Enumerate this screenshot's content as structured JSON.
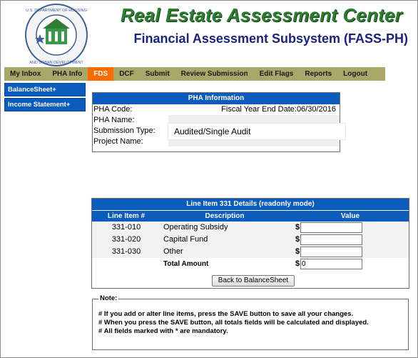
{
  "header": {
    "title": "Real Estate Assessment Center",
    "subtitle": "Financial Assessment Subsystem (FASS-PH)",
    "seal_text": "U.S. DEPARTMENT OF HOUSING AND URBAN DEVELOPMENT"
  },
  "nav": {
    "items": [
      "My Inbox",
      "PHA Info",
      "FDS",
      "DCF",
      "Submit",
      "Review Submission",
      "Edit Flags",
      "Reports",
      "Logout"
    ],
    "active": "FDS"
  },
  "leftmenu": {
    "items": [
      "BalanceSheet+",
      "Income Statement+"
    ]
  },
  "pha_info": {
    "heading": "PHA Information",
    "code_label": "PHA Code:",
    "fye_label": "Fiscal Year End Date:06/30/2016",
    "name_label": "PHA Name:",
    "submission_type_label": "Submission Type:",
    "submission_type_value": "Audited/Single Audit",
    "project_name_label": "Project Name:"
  },
  "line_item": {
    "heading": "Line Item 331 Details (readonly mode)",
    "columns": [
      "Line Item #",
      "Description",
      "Value"
    ],
    "rows": [
      {
        "code": "331-010",
        "desc": "Operating Subsidy",
        "value": ""
      },
      {
        "code": "331-020",
        "desc": "Capital Fund",
        "value": ""
      },
      {
        "code": "331-030",
        "desc": "Other",
        "value": ""
      }
    ],
    "currency": "$",
    "total_label": "Total Amount",
    "total_value": "0",
    "back_button": "Back to BalanceSheet"
  },
  "note": {
    "legend": "Note:",
    "lines": [
      "# If you add or alter line items, press the SAVE button to save all your changes.",
      "# When you press the SAVE button, all totals fields will be calculated and displayed.",
      "# All fields marked with * are mandatory."
    ]
  }
}
